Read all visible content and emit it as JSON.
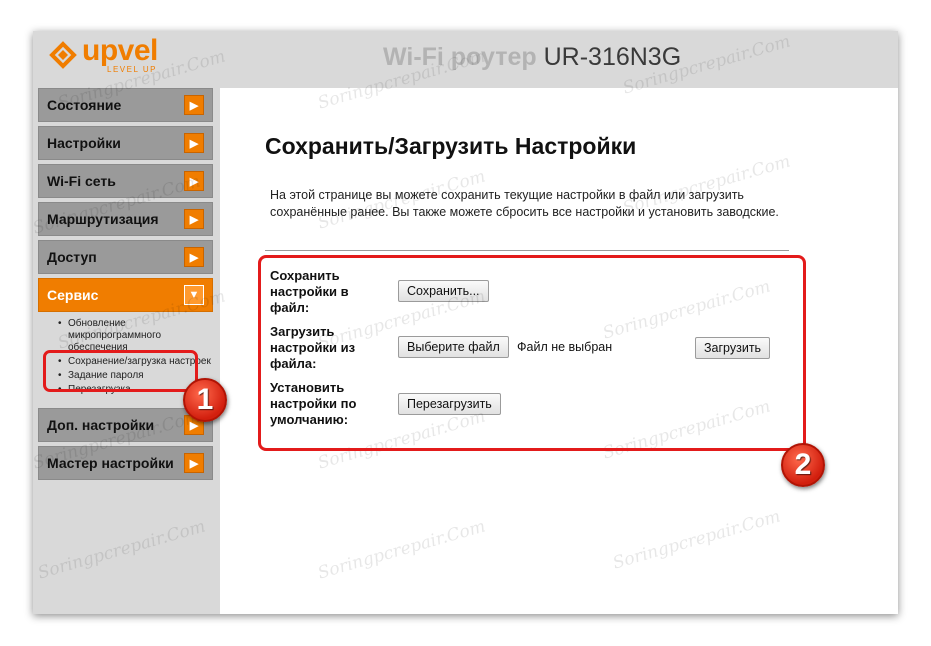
{
  "header": {
    "logo_word": "upvel",
    "logo_tagline": "LEVEL UP",
    "title_prefix": "Wi-Fi роутер",
    "model": "UR-316N3G",
    "brand_color": "#f07d00"
  },
  "sidebar": {
    "items": [
      {
        "label": "Состояние",
        "icon": "chevron-right-icon"
      },
      {
        "label": "Настройки",
        "icon": "chevron-right-icon"
      },
      {
        "label": "Wi-Fi сеть",
        "icon": "chevron-right-icon"
      },
      {
        "label": "Маршрутизация",
        "icon": "chevron-right-icon"
      },
      {
        "label": "Доступ",
        "icon": "chevron-right-icon"
      },
      {
        "label": "Сервис",
        "icon": "chevron-down-icon",
        "active": true
      },
      {
        "label": "Доп. настройки",
        "icon": "chevron-right-icon"
      },
      {
        "label": "Мастер настройки",
        "icon": "chevron-right-icon"
      }
    ],
    "service_submenu": [
      "Обновление микропрограммного обеспечения",
      "Сохранение/загрузка настроек",
      "Задание пароля",
      "Перезагрузка"
    ]
  },
  "main": {
    "title": "Сохранить/Загрузить Настройки",
    "intro": "На этой странице вы можете сохранить текущие настройки в файл или загрузить сохранённые ранее. Вы также можете сбросить все настройки и установить заводские.",
    "save_label": "Сохранить настройки в файл:",
    "save_button": "Сохранить...",
    "load_label": "Загрузить настройки из файла:",
    "choose_file_button": "Выберите файл",
    "no_file_text": "Файл не выбран",
    "upload_button": "Загрузить",
    "reset_label": "Установить настройки по умолчанию:",
    "reset_button": "Перезагрузить"
  },
  "annotations": {
    "badge1": "1",
    "badge2": "2",
    "highlight_color": "#e31b1b"
  },
  "watermark": "Soringpcrepair.Com"
}
